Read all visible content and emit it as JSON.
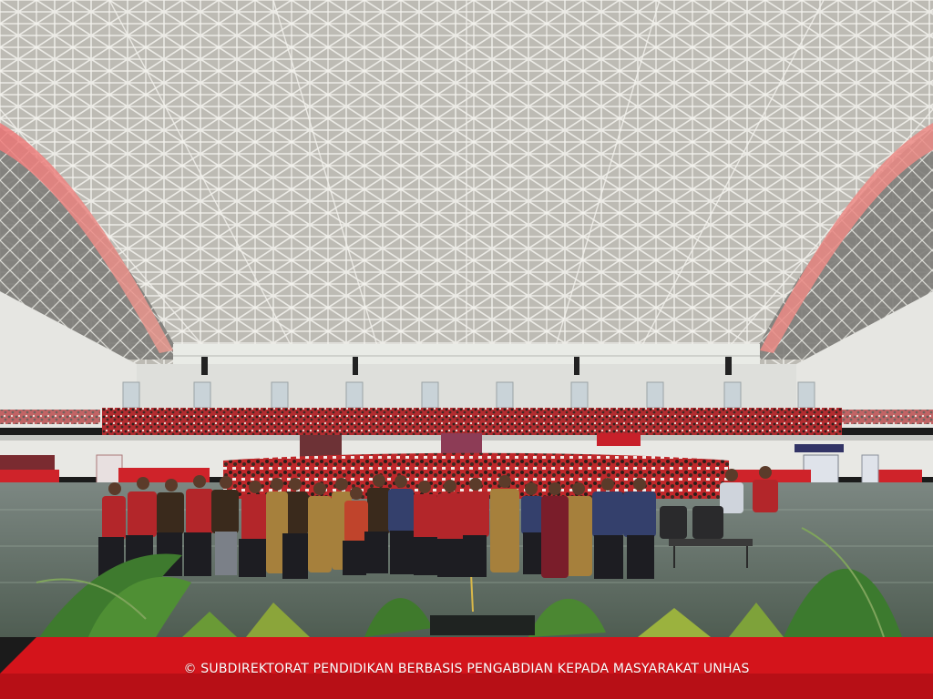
{
  "caption": "© SUBDIREKTORAT PENDIDIKAN BERBASIS PENGABDIAN KEPADA MASYARAKAT UNHAS",
  "colors": {
    "carpet": "#d4141b",
    "crowd_shirts": "#b3262a",
    "roof_frame": "#c9c8c2",
    "floor": "#5d6c60",
    "walls": "#e3e3df"
  }
}
